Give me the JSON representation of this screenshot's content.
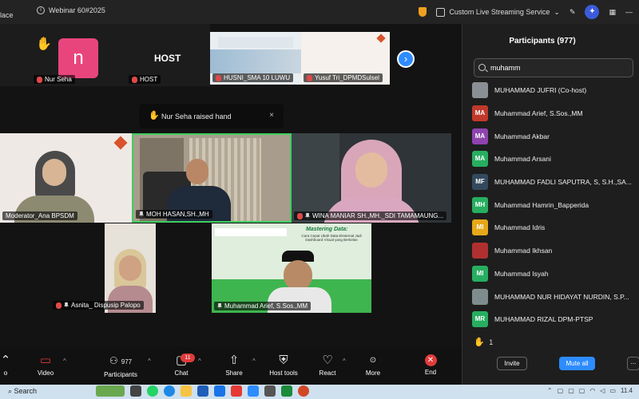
{
  "window": {
    "app_partial": "lace",
    "meeting_title": "Webinar 60#2025",
    "streaming_label": "Custom Live Streaming Service"
  },
  "top_strip": {
    "tiles": [
      {
        "name": "Nur Seha",
        "avatar_letter": "n"
      },
      {
        "name": "HOST",
        "center_label": "HOST"
      },
      {
        "name": "HUSNI_SMA 10 LUWU"
      },
      {
        "name": "Yusuf Tri_DPMDSulsel"
      }
    ]
  },
  "toast": {
    "text": "Nur Seha raised hand",
    "close": "×"
  },
  "gallery": {
    "tiles": [
      {
        "name": "Moderator_Ana BPSDM"
      },
      {
        "name": "MOH HASAN,SH.,MH"
      },
      {
        "name": "WINA MANIAR SH.,MH._SDI TAMAMAUNG..."
      },
      {
        "name": "Asnita_ Dispusip Palopo"
      },
      {
        "name": "Muhammad Arief, S.Sos.,MM",
        "slide_title": "Mastering Data:",
        "slide_sub": "Cara Cepat Ubah Data Eksternal Jadi Dashboard Visual yang Berkelas"
      }
    ]
  },
  "toolbar": {
    "items": [
      {
        "label": "o",
        "glyph": "🎙"
      },
      {
        "label": "Video",
        "glyph": "▭"
      },
      {
        "label": "Participants",
        "glyph": "👥",
        "count": "977"
      },
      {
        "label": "Chat",
        "glyph": "💬",
        "badge": "11"
      },
      {
        "label": "Share",
        "glyph": "⬆"
      },
      {
        "label": "Host tools",
        "glyph": "⛨"
      },
      {
        "label": "React",
        "glyph": "♡"
      },
      {
        "label": "More",
        "glyph": "•••"
      },
      {
        "label": "End",
        "glyph": "✕"
      }
    ]
  },
  "participants": {
    "title": "Participants (977)",
    "search_value": "muhamm",
    "list": [
      {
        "initials": "",
        "name": "MUHAMMAD JUFRI (Co-host)",
        "color": "#8a8f96",
        "photo": true
      },
      {
        "initials": "MA",
        "name": "Muhammad Arief, S.Sos.,MM",
        "color": "#c0392b"
      },
      {
        "initials": "MA",
        "name": "Muhammad Akbar",
        "color": "#8e44ad"
      },
      {
        "initials": "MA",
        "name": "Muhammad Arsani",
        "color": "#27ae60"
      },
      {
        "initials": "MF",
        "name": "MUHAMMAD FADLI SAPUTRA, S, S.H.,SA...",
        "color": "#34495e"
      },
      {
        "initials": "MH",
        "name": "Muhammad Hamrin_Bapperida",
        "color": "#27ae60"
      },
      {
        "initials": "MI",
        "name": "Muhammad Idris",
        "color": "#e6a817"
      },
      {
        "initials": "",
        "name": "Muhammad Ikhsan",
        "color": "#b03030",
        "photo": true
      },
      {
        "initials": "MI",
        "name": "Muhammad Isyah",
        "color": "#27ae60"
      },
      {
        "initials": "",
        "name": "MUHAMMAD NUR HIDAYAT NURDIN, S.P...",
        "color": "#7f8c8d",
        "photo": true
      },
      {
        "initials": "MR",
        "name": "MUHAMMAD RIZAL DPM-PTSP",
        "color": "#27ae60"
      }
    ],
    "raised_hands": "1",
    "invite_label": "Invite",
    "mute_all_label": "Mute all",
    "more_label": "..."
  },
  "taskbar": {
    "search_label": "Search",
    "clock": "11.4"
  }
}
